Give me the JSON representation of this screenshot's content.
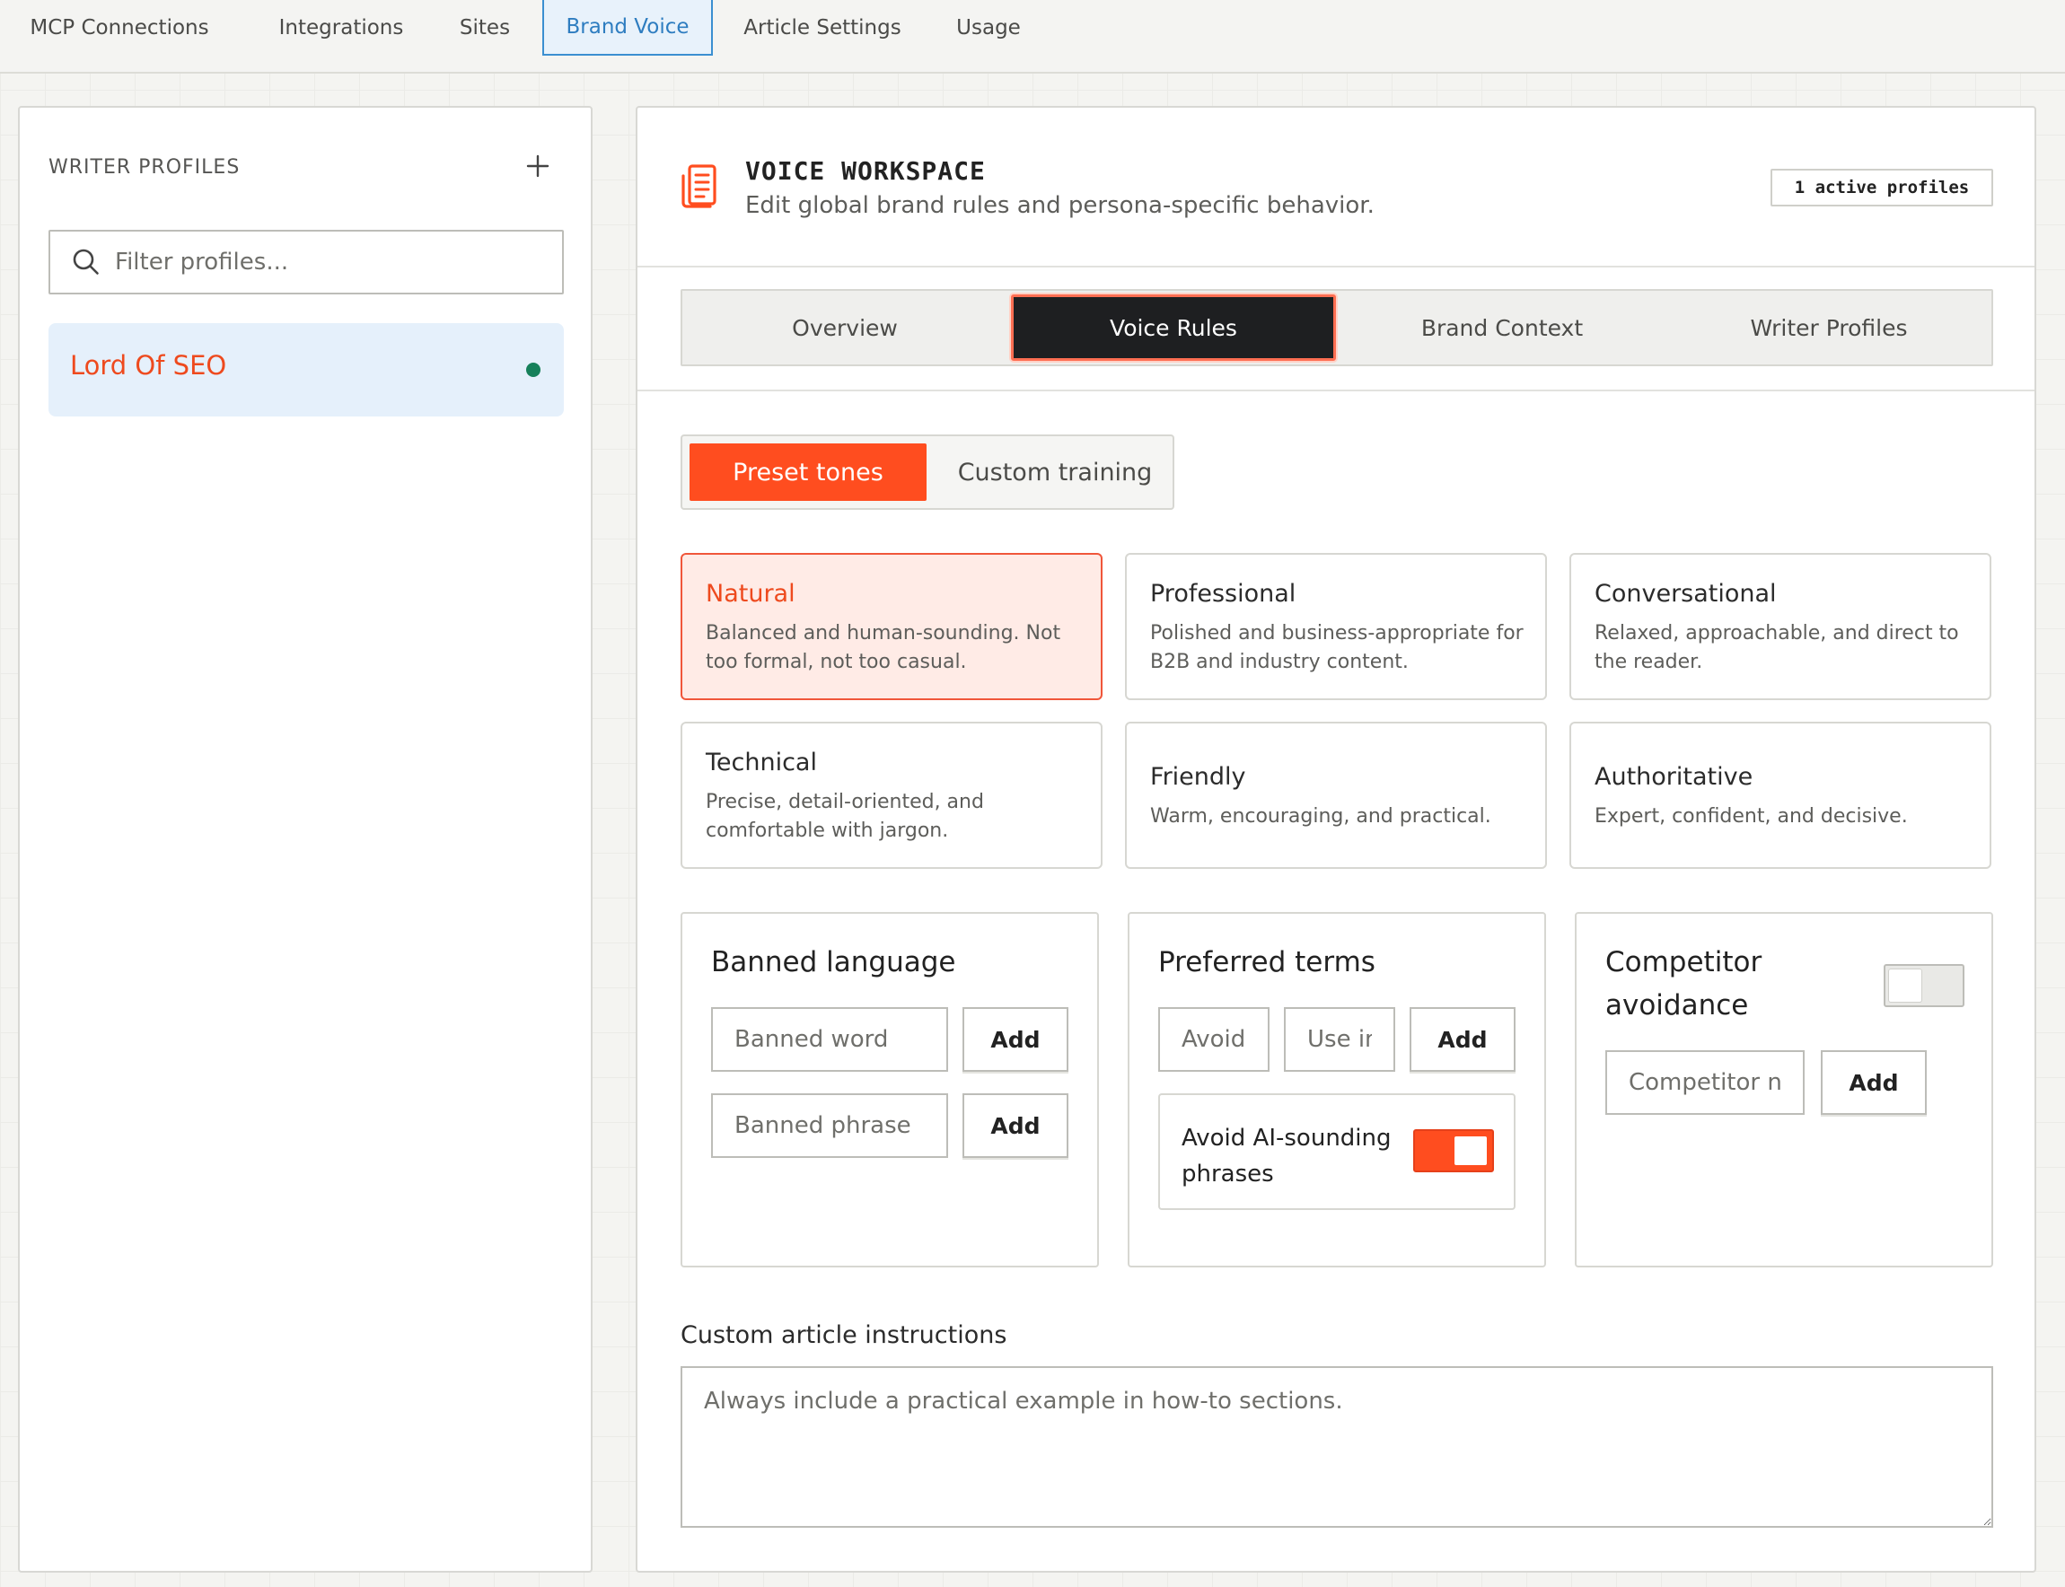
{
  "topnav": {
    "tabs": [
      {
        "label": "MCP Connections"
      },
      {
        "label": "Integrations"
      },
      {
        "label": "Sites"
      },
      {
        "label": "Brand Voice"
      },
      {
        "label": "Article Settings"
      },
      {
        "label": "Usage"
      }
    ],
    "active_tab": "Brand Voice"
  },
  "sidebar": {
    "title": "WRITER PROFILES",
    "add_icon": "plus-icon",
    "filter_placeholder": "Filter profiles...",
    "profiles": [
      {
        "name": "Lord Of SEO",
        "status": "active",
        "status_color": "#16805a"
      }
    ]
  },
  "workspace": {
    "icon": "document-stack-icon",
    "title": "VOICE WORKSPACE",
    "subtitle": "Edit global brand rules and persona-specific behavior.",
    "badge": "1 active profiles",
    "tabs": [
      {
        "label": "Overview"
      },
      {
        "label": "Voice Rules"
      },
      {
        "label": "Brand Context"
      },
      {
        "label": "Writer Profiles"
      }
    ],
    "active_tab": "Voice Rules"
  },
  "tone_mode": {
    "options": [
      {
        "label": "Preset tones"
      },
      {
        "label": "Custom training"
      }
    ],
    "selected": "Preset tones"
  },
  "tones": [
    {
      "name": "Natural",
      "desc": "Balanced and human-sounding. Not too formal, not too casual.",
      "selected": true
    },
    {
      "name": "Professional",
      "desc": "Polished and business-appropriate for B2B and industry content."
    },
    {
      "name": "Conversational",
      "desc": "Relaxed, approachable, and direct to the reader."
    },
    {
      "name": "Technical",
      "desc": "Precise, detail-oriented, and comfortable with jargon."
    },
    {
      "name": "Friendly",
      "desc": "Warm, encouraging, and practical."
    },
    {
      "name": "Authoritative",
      "desc": "Expert, confident, and decisive."
    }
  ],
  "banned_language": {
    "title": "Banned language",
    "word_placeholder": "Banned word",
    "phrase_placeholder": "Banned phrase",
    "add_label": "Add"
  },
  "preferred_terms": {
    "title": "Preferred terms",
    "avoid_placeholder": "Avoid",
    "use_placeholder": "Use instead",
    "add_label": "Add",
    "ai_toggle_label": "Avoid AI-sounding phrases",
    "ai_toggle_on": true
  },
  "competitor": {
    "title": "Competitor avoidance",
    "toggle_on": false,
    "name_placeholder": "Competitor name",
    "add_label": "Add"
  },
  "custom_instructions": {
    "label": "Custom article instructions",
    "placeholder": "Always include a practical example in how-to sections."
  },
  "colors": {
    "accent": "#ff4d1f",
    "link_blue": "#2e7dc0",
    "active_dot": "#16805a"
  }
}
